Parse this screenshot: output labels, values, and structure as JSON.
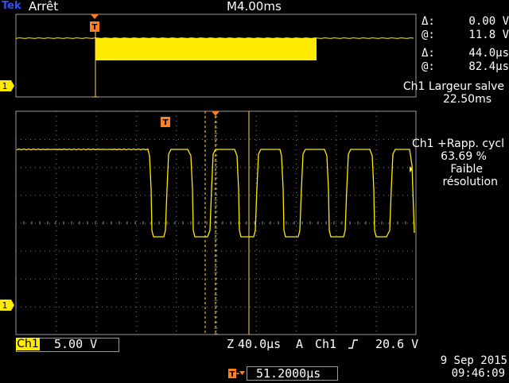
{
  "header": {
    "brand": "Tek",
    "run_state": "Arrêt",
    "main_timebase": "M4.00ms"
  },
  "cursors": {
    "delta_v_symbol": "Δ:",
    "delta_v": "0.00 V",
    "at_v_symbol": "@:",
    "at_v": "11.8 V",
    "delta_t_symbol": "Δ:",
    "delta_t": "44.0µs",
    "at_t_symbol": "@:",
    "at_t": "82.4µs"
  },
  "measurements": [
    {
      "label": "Ch1 Largeur salve",
      "value": "22.50ms"
    },
    {
      "label": "Ch1 +Rapp. cycl",
      "value": "63.69 %"
    },
    {
      "note1": "Faible",
      "note2": "résolution"
    }
  ],
  "channel": {
    "name": "Ch1",
    "scale": "5.00 V",
    "marker": "1"
  },
  "horizontal": {
    "zoom_label": "Z",
    "zoom_scale": "40.0µs",
    "acq_label": "A",
    "trig_source": "Ch1",
    "trig_slope_icon": "rising-edge-icon",
    "trig_level": "20.6 V"
  },
  "trigger_position": "51.2000µs",
  "datetime": {
    "date": "9 Sep  2015",
    "time": "09:46:09"
  },
  "colors": {
    "trace": "#ffeb00",
    "trigger_marker": "#ff7f1e",
    "brand": "#3050ff",
    "grid": "#8a8a8a",
    "cursor": "#ffd84a"
  }
}
